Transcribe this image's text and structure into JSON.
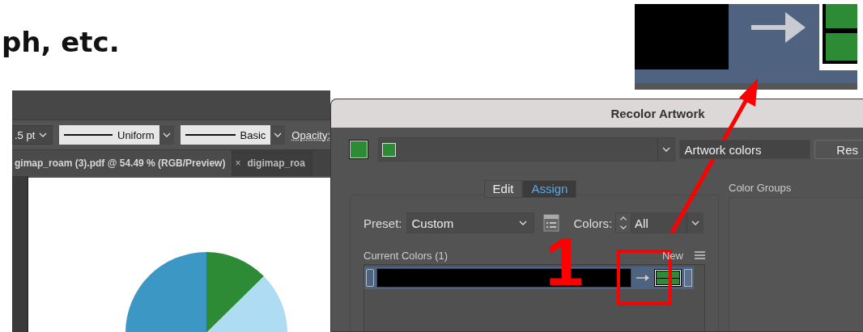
{
  "heading": "ph, etc.",
  "toolbar": {
    "stroke_weight": ".5 pt",
    "profile": "Uniform",
    "brush": "Basic",
    "opacity_label": "Opacity:"
  },
  "document_tabs": [
    {
      "label": "gimap_roam (3).pdf @ 54.49 % (RGB/Preview)",
      "selected": true
    },
    {
      "label": "digimap_roa",
      "close_glyph": "×",
      "selected": false
    }
  ],
  "dialog": {
    "title": "Recolor Artwork",
    "color_group_field": "Artwork colors",
    "reset_button": "Res",
    "tabs": [
      {
        "label": "Edit",
        "selected": false
      },
      {
        "label": "Assign",
        "selected": true
      }
    ],
    "preset_label": "Preset:",
    "preset_value": "Custom",
    "colors_label": "Colors:",
    "colors_value": "All",
    "current_colors_label": "Current Colors (1)",
    "new_label": "New",
    "color_groups_label": "Color Groups"
  },
  "annotation": {
    "label": "1"
  }
}
